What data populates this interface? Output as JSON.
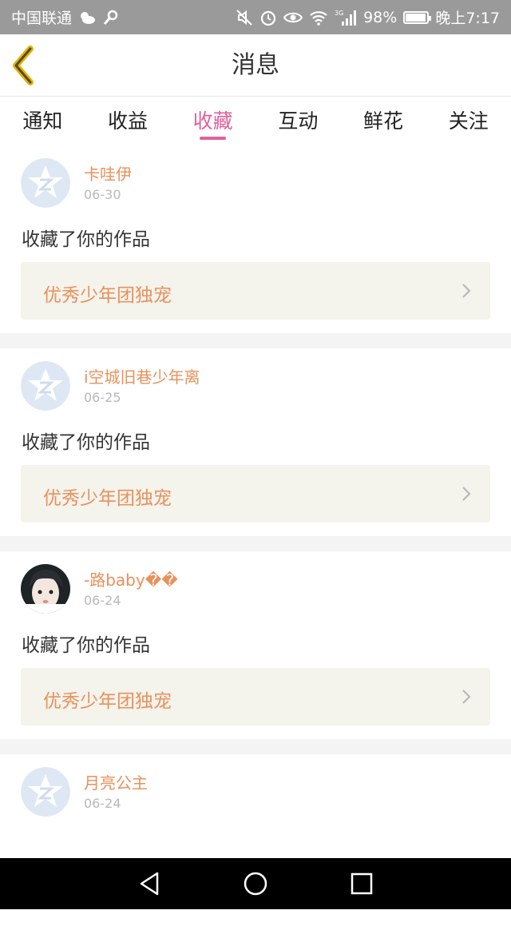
{
  "status_bar": {
    "carrier": "中国联通",
    "icons": [
      "weather-icon",
      "key-icon",
      "mute-icon",
      "alarm-icon",
      "eye-icon",
      "wifi-icon",
      "signal-icon",
      "battery-icon"
    ],
    "network": "3G",
    "battery": "98%",
    "battery_level": 0.98,
    "time": "晚上7:17"
  },
  "header": {
    "title": "消息",
    "back_icon": "chevron-left-icon",
    "back_color": "#e8b200"
  },
  "tabs": [
    {
      "label": "通知"
    },
    {
      "label": "收益"
    },
    {
      "label": "收藏",
      "active": true
    },
    {
      "label": "互动"
    },
    {
      "label": "鲜花"
    },
    {
      "label": "关注"
    }
  ],
  "accent_color": "#e1609d",
  "name_color": "#e8915b",
  "messages": [
    {
      "user": "卡哇伊",
      "date": "06-30",
      "action": "收藏了你的作品",
      "work_title": "优秀少年团独宠",
      "avatar": "default"
    },
    {
      "user": "i空城旧巷少年离",
      "date": "06-25",
      "action": "收藏了你的作品",
      "work_title": "优秀少年团独宠",
      "avatar": "default"
    },
    {
      "user": "-路baby��",
      "date": "06-24",
      "action": "收藏了你的作品",
      "work_title": "优秀少年团独宠",
      "avatar": "photo"
    },
    {
      "user": "月亮公主",
      "date": "06-24",
      "avatar": "default"
    }
  ],
  "bottom_nav": {
    "icons": [
      "back-triangle-icon",
      "home-circle-icon",
      "recents-square-icon"
    ]
  }
}
